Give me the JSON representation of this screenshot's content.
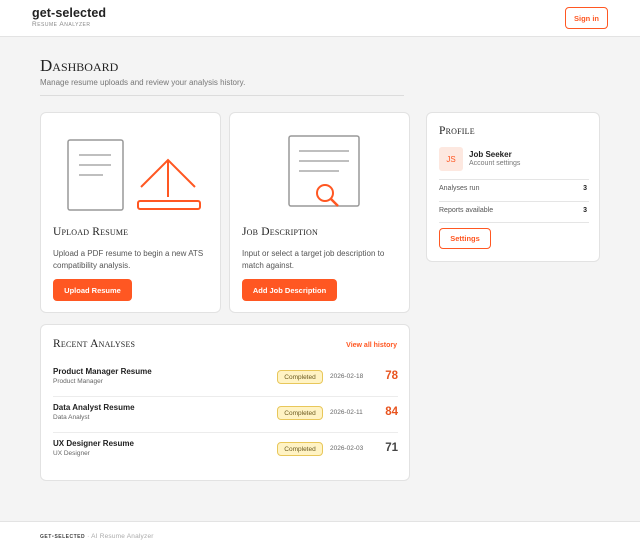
{
  "header": {
    "brand_name": "get-selected",
    "brand_sub": "Resume Analyzer",
    "signin_label": "Sign in"
  },
  "page": {
    "title": "Dashboard",
    "subtitle": "Manage resume uploads and review your analysis history."
  },
  "upload": {
    "title": "Upload Resume",
    "description": "Upload a PDF resume to begin a new ATS compatibility analysis.",
    "button_label": "Upload Resume",
    "icon": "document-upload-icon"
  },
  "job": {
    "title": "Job Description",
    "description": "Input or select a target job description to match against.",
    "button_label": "Add Job Description",
    "icon": "document-search-icon"
  },
  "profile": {
    "title": "Profile",
    "initials": "JS",
    "name": "Job Seeker",
    "role": "Account settings",
    "stats": [
      {
        "label": "Analyses run",
        "value": "3"
      },
      {
        "label": "Reports available",
        "value": "3"
      }
    ],
    "settings_label": "Settings"
  },
  "recent": {
    "title": "Recent Analyses",
    "view_all_label": "View all history",
    "rows": [
      {
        "title": "Product Manager Resume",
        "sub": "Product Manager",
        "status": "Completed",
        "date": "2026-02-18",
        "score": "78",
        "score_color": "#e8541f"
      },
      {
        "title": "Data Analyst Resume",
        "sub": "Data Analyst",
        "status": "Completed",
        "date": "2026-02-11",
        "score": "84",
        "score_color": "#e8541f"
      },
      {
        "title": "UX Designer Resume",
        "sub": "UX Designer",
        "status": "Completed",
        "date": "2026-02-03",
        "score": "71",
        "score_color": "#444444"
      }
    ]
  },
  "footer": {
    "brand": "get-selected",
    "text": " · AI Resume Analyzer"
  },
  "colors": {
    "accent": "#ff5722",
    "badge_bg": "#fff3c4"
  }
}
